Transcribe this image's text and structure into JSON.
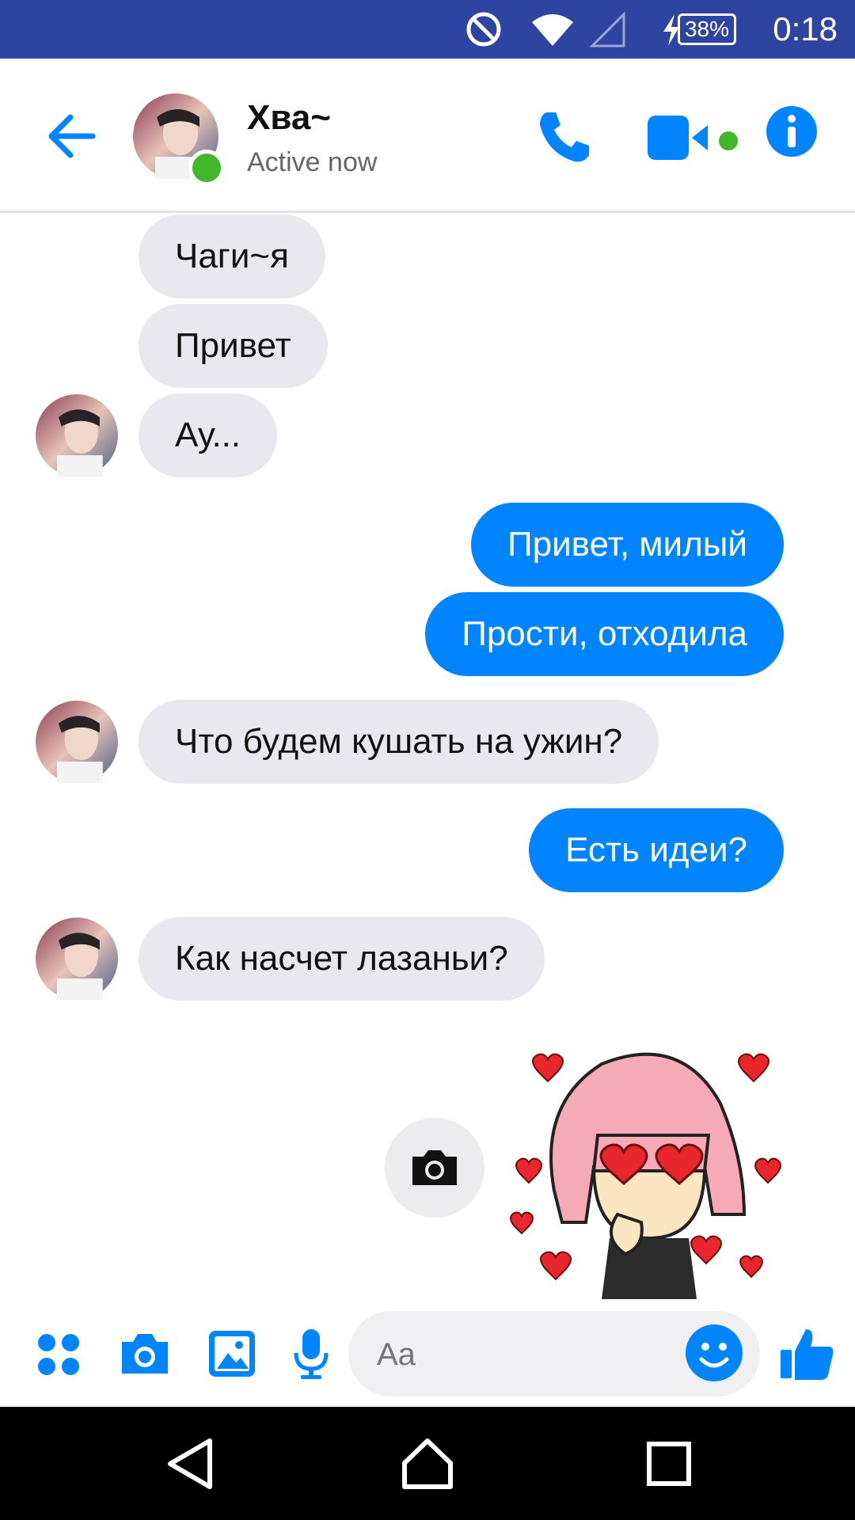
{
  "status_bar": {
    "battery": "38%",
    "time": "0:18",
    "icons": [
      "do-not-disturb-icon",
      "wifi-icon",
      "signal-icon",
      "charging-icon",
      "battery-icon"
    ]
  },
  "header": {
    "contact_name": "Хва~",
    "contact_status": "Active now",
    "icons": [
      "back-arrow-icon",
      "phone-icon",
      "video-call-icon",
      "info-icon"
    ]
  },
  "messages": [
    {
      "direction": "in",
      "text": "Чаги~я"
    },
    {
      "direction": "in",
      "text": "Привет"
    },
    {
      "direction": "in",
      "text": "Ау..."
    },
    {
      "direction": "out",
      "text": "Привет, милый"
    },
    {
      "direction": "out",
      "text": "Прости, отходила"
    },
    {
      "direction": "in",
      "text": "Что будем кушать на ужин?"
    },
    {
      "direction": "out",
      "text": "Есть идеи?"
    },
    {
      "direction": "in",
      "text": "Как насчет лазаньи?"
    },
    {
      "direction": "out",
      "type": "sticker",
      "icon": "girl-with-hearts-sticker"
    }
  ],
  "composer": {
    "placeholder": "Aa",
    "icons": [
      "apps-grid-icon",
      "camera-icon",
      "gallery-icon",
      "microphone-icon",
      "emoji-icon",
      "thumbs-up-icon"
    ]
  },
  "nav_bar": {
    "icons": [
      "back-nav-icon",
      "home-nav-icon",
      "recents-nav-icon"
    ]
  },
  "colors": {
    "status_bar": "#2d44a1",
    "accent": "#0084ff",
    "incoming_bubble": "#e9e8ee",
    "online": "#42b72a"
  }
}
